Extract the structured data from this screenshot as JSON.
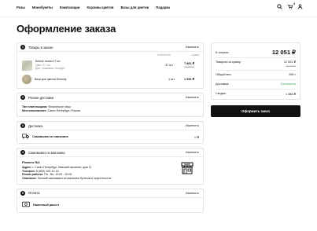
{
  "header": {
    "nav": [
      "Розы",
      "Монобукеты",
      "Композиции",
      "Корзины цветов",
      "Вазы для цветов",
      "Подарки"
    ],
    "cart_count": "4"
  },
  "page": {
    "title": "Оформление заказа"
  },
  "sections": {
    "items": {
      "number": "1",
      "title": "Товары в заказе",
      "change": "Изменить",
      "col_qty": "Количество",
      "col_sum": "Сумма",
      "rows": [
        {
          "name": "Белые лилии 17 шт",
          "line2": "Цвет: 17 шт",
          "line3": "Доп. упаковка: Sunlight",
          "qty": "37 шт",
          "price": "7 881 ₽",
          "old_price": "16 920 ₽"
        },
        {
          "name": "Ваза для цветов Serenity",
          "qty": "1 шт",
          "price": "1 990 ₽"
        }
      ]
    },
    "region": {
      "number": "2",
      "title": "Регион доставки",
      "change": "Изменить",
      "payer_label": "Тип плательщика:",
      "payer_value": "Физическое лицо",
      "location_label": "Местоположение:",
      "location_value": "Санкт-Петербург, Россия"
    },
    "delivery": {
      "number": "3",
      "title": "Доставка",
      "change": "Изменить",
      "option": "Самовывоз из магазина",
      "price": "0 ₽"
    },
    "pickup": {
      "number": "4",
      "title": "Самовывоз из магазина",
      "change": "Изменить",
      "store_name": "Flowers №1",
      "address_label": "Адрес:",
      "address": "г. Санкт-Петербург, Невский проспект, дом 11",
      "phone_label": "Телефон:",
      "phone": "8 (800) 100-10-10",
      "hours_label": "Режим работы:",
      "hours": "Пн - Вс: 10:00 - 20:00",
      "desc_label": "Описание:",
      "desc": "Личный самовывоз из магазина бутиком в окрестностях"
    },
    "payment": {
      "number": "5",
      "title": "Оплата",
      "change": "Изменить",
      "option": "Наличный расчет"
    }
  },
  "summary": {
    "total_label": "К оплате:",
    "total": "12 051 ₽",
    "goods_label": "Товаров на сумму:",
    "goods_sum": "12 051 ₽",
    "goods_old": "15 020 ₽",
    "weight_label": "Общий вес:",
    "weight": "250 г",
    "delivery_label": "Доставка:",
    "delivery": "Бесплатно",
    "discount_label": "Скидка:",
    "discount": "1 388 ₽",
    "button": "Оформить заказ"
  }
}
